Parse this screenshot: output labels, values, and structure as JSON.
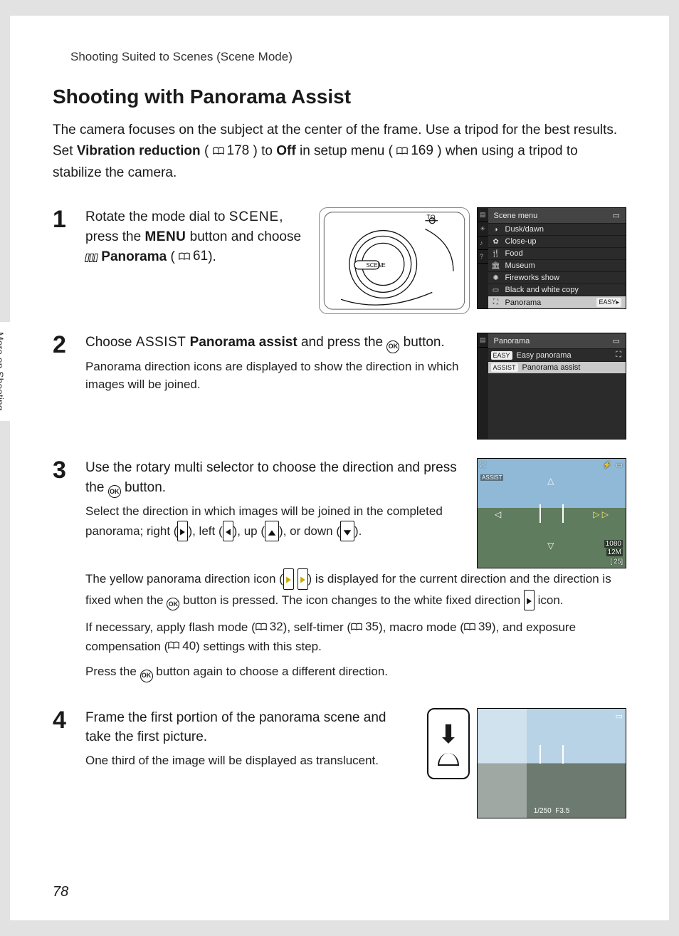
{
  "breadcrumb": "Shooting Suited to Scenes (Scene Mode)",
  "section_title": "Shooting with Panorama Assist",
  "side_tab": "More on Shooting",
  "page_number": "78",
  "intro": {
    "part1": "The camera focuses on the subject at the center of the frame. Use a tripod for the best results. Set ",
    "bold1": "Vibration reduction",
    "part2": " (",
    "ref1": "178",
    "part3": ") to ",
    "bold2": "Off",
    "part4": " in setup menu (",
    "ref2": "169",
    "part5": ") when using a tripod to stabilize the camera."
  },
  "steps": {
    "s1": {
      "num": "1",
      "h_a": "Rotate the mode dial to ",
      "scene": "SCENE",
      "h_b": ", press the ",
      "menu": "MENU",
      "h_c": " button and choose ",
      "pano_label": "Panorama",
      "h_d": " (",
      "ref": "61",
      "h_e": ")."
    },
    "s2": {
      "num": "2",
      "h_a": "Choose ",
      "assist": "ASSIST",
      "bold": "Panorama assist",
      "h_b": " and press the ",
      "h_c": " button.",
      "desc": "Panorama direction icons are displayed to show the direction in which images will be joined."
    },
    "s3": {
      "num": "3",
      "h_a": "Use the rotary multi selector to choose the direction and press the ",
      "h_b": " button.",
      "d1a": "Select the direction in which images will be joined in the completed panorama; right (",
      "d1b": "), left (",
      "d1c": "), up (",
      "d1d": "), or down (",
      "d1e": ").",
      "d2a": "The yellow panorama direction icon (",
      "d2b": ") is displayed for the current direction and the direction is fixed when the ",
      "d2c": " button is pressed. The icon changes to the white fixed direction ",
      "d2d": " icon.",
      "d3a": "If necessary, apply flash mode (",
      "ref_flash": "32",
      "d3b": "), self-timer (",
      "ref_timer": "35",
      "d3c": "), macro mode (",
      "ref_macro": "39",
      "d3d": "), and exposure compensation (",
      "ref_ec": "40",
      "d3e": ") settings with this step.",
      "d4a": "Press the ",
      "d4b": " button again to choose a different direction."
    },
    "s4": {
      "num": "4",
      "heading": "Frame the first portion of the panorama scene and take the first picture.",
      "desc": "One third of the image will be displayed as translucent.",
      "info_shutter": "1/250",
      "info_f": "F3.5"
    }
  },
  "lcd_scene": {
    "title": "Scene menu",
    "items": [
      {
        "icon": "◑",
        "label": "Dusk/dawn"
      },
      {
        "icon": "✿",
        "label": "Close-up"
      },
      {
        "icon": "🍴",
        "label": "Food"
      },
      {
        "icon": "🏛",
        "label": "Museum"
      },
      {
        "icon": "✺",
        "label": "Fireworks show"
      },
      {
        "icon": "▭",
        "label": "Black and white copy"
      },
      {
        "icon": "⛶",
        "label": "Panorama"
      }
    ],
    "easy_badge": "EASY▸"
  },
  "lcd_pano": {
    "title": "Panorama",
    "items": [
      {
        "tag": "EASY",
        "label": "Easy panorama"
      },
      {
        "tag": "ASSIST",
        "label": "Panorama assist"
      }
    ]
  },
  "preview3": {
    "assist": "ASSIST",
    "shots": "[   25]"
  }
}
